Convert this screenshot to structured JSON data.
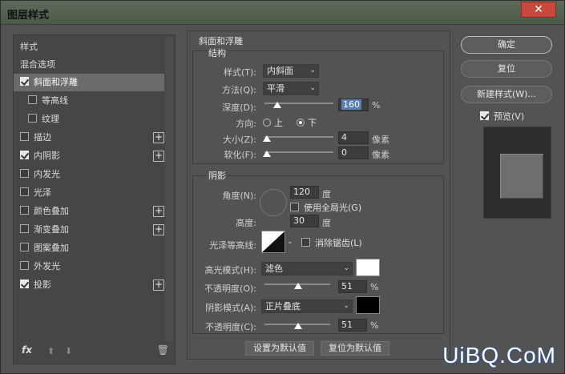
{
  "window": {
    "title": "图层样式",
    "close_label": "✕"
  },
  "styles_list": {
    "items": [
      {
        "label": "样式",
        "checkbox": false,
        "checked": false,
        "plus": false,
        "sub": false
      },
      {
        "label": "混合选项",
        "checkbox": false,
        "checked": false,
        "plus": false,
        "sub": false
      },
      {
        "label": "斜面和浮雕",
        "checkbox": true,
        "checked": true,
        "plus": false,
        "sub": false,
        "selected": true
      },
      {
        "label": "等高线",
        "checkbox": true,
        "checked": false,
        "plus": false,
        "sub": true
      },
      {
        "label": "纹理",
        "checkbox": true,
        "checked": false,
        "plus": false,
        "sub": true
      },
      {
        "label": "描边",
        "checkbox": true,
        "checked": false,
        "plus": true,
        "sub": false
      },
      {
        "label": "内阴影",
        "checkbox": true,
        "checked": true,
        "plus": true,
        "sub": false
      },
      {
        "label": "内发光",
        "checkbox": true,
        "checked": false,
        "plus": false,
        "sub": false
      },
      {
        "label": "光泽",
        "checkbox": true,
        "checked": false,
        "plus": false,
        "sub": false
      },
      {
        "label": "颜色叠加",
        "checkbox": true,
        "checked": false,
        "plus": true,
        "sub": false
      },
      {
        "label": "渐变叠加",
        "checkbox": true,
        "checked": false,
        "plus": true,
        "sub": false
      },
      {
        "label": "图案叠加",
        "checkbox": true,
        "checked": false,
        "plus": false,
        "sub": false
      },
      {
        "label": "外发光",
        "checkbox": true,
        "checked": false,
        "plus": false,
        "sub": false
      },
      {
        "label": "投影",
        "checkbox": true,
        "checked": true,
        "plus": true,
        "sub": false
      }
    ],
    "plus_label": "+",
    "footer": {
      "fx": "fx",
      "up": "⬆",
      "down": "⬇",
      "trash": "🗑"
    }
  },
  "bevel": {
    "section_title": "斜面和浮雕",
    "structure_title": "结构",
    "style_label": "样式(T):",
    "style_value": "内斜面",
    "technique_label": "方法(Q):",
    "technique_value": "平滑",
    "depth_label": "深度(D):",
    "depth_value": "160",
    "depth_unit": "%",
    "direction_label": "方向:",
    "direction_up": "上",
    "direction_down": "下",
    "direction_selected": "下",
    "size_label": "大小(Z):",
    "size_value": "4",
    "size_unit": "像素",
    "soften_label": "软化(F):",
    "soften_value": "0",
    "soften_unit": "像素"
  },
  "shading": {
    "title": "阴影",
    "angle_label": "角度(N):",
    "angle_value": "120",
    "angle_unit": "度",
    "global_light_label": "使用全局光(G)",
    "altitude_label": "高度:",
    "altitude_value": "30",
    "altitude_unit": "度",
    "gloss_contour_label": "光泽等高线:",
    "antialiased_label": "消除锯齿(L)",
    "highlight_mode_label": "高光模式(H):",
    "highlight_mode_value": "滤色",
    "highlight_opacity_label": "不透明度(O):",
    "highlight_opacity_value": "51",
    "highlight_color": "#ffffff",
    "shadow_mode_label": "阴影模式(A):",
    "shadow_mode_value": "正片叠底",
    "shadow_opacity_label": "不透明度(C):",
    "shadow_opacity_value": "51",
    "shadow_color": "#000000",
    "opacity_unit": "%",
    "make_default_label": "设置为默认值",
    "reset_default_label": "复位为默认值"
  },
  "actions": {
    "ok_label": "确定",
    "reset_label": "复位",
    "new_style_label": "新建样式(W)...",
    "preview_label": "预览(V)",
    "preview_checked": true
  },
  "watermark": "UiBQ.CoM"
}
